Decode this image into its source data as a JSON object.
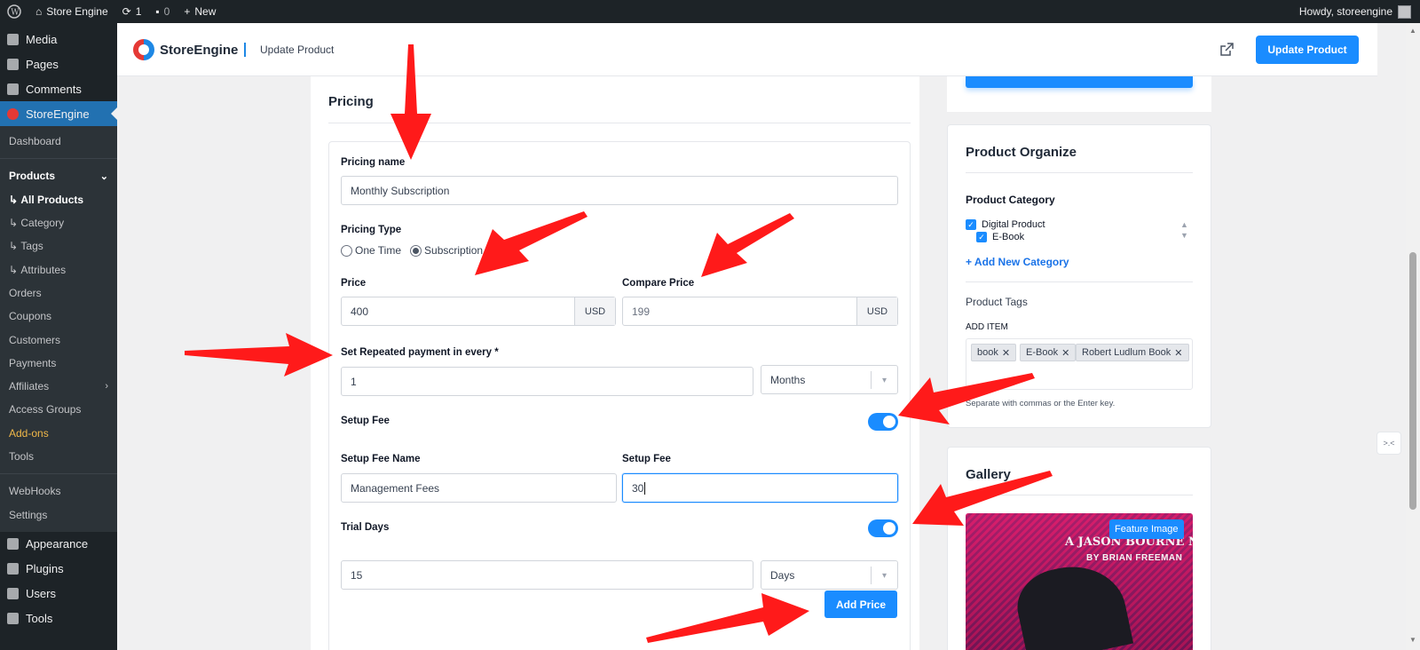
{
  "adminbar": {
    "site_name": "Store Engine",
    "updates_count": "1",
    "comments_count": "0",
    "new_label": "New",
    "howdy": "Howdy, storeengine"
  },
  "sidebar": {
    "top_items": [
      {
        "label": "Media",
        "icon": "media-icon"
      },
      {
        "label": "Pages",
        "icon": "pages-icon"
      },
      {
        "label": "Comments",
        "icon": "comments-icon"
      },
      {
        "label": "StoreEngine",
        "icon": "storeengine-icon"
      }
    ],
    "sub_items": [
      "Dashboard",
      "Products",
      "All Products",
      "Category",
      "Tags",
      "Attributes",
      "Orders",
      "Coupons",
      "Customers",
      "Payments",
      "Affiliates",
      "Access Groups",
      "Add-ons",
      "Tools",
      "WebHooks",
      "Settings"
    ],
    "bottom_items": [
      {
        "label": "Appearance",
        "icon": "appearance-icon"
      },
      {
        "label": "Plugins",
        "icon": "plugins-icon"
      },
      {
        "label": "Users",
        "icon": "users-icon"
      },
      {
        "label": "Tools",
        "icon": "tools-icon"
      }
    ]
  },
  "header": {
    "brand": "StoreEngine",
    "page_name": "Update Product",
    "update_button": "Update Product"
  },
  "pricing": {
    "title": "Pricing",
    "name_label": "Pricing name",
    "name_value": "Monthly Subscription",
    "type_label": "Pricing Type",
    "type_options": [
      "One Time",
      "Subscription"
    ],
    "type_selected": "Subscription",
    "price_label": "Price",
    "price_value": "400",
    "price_currency": "USD",
    "compare_label": "Compare Price",
    "compare_value": "199",
    "compare_currency": "USD",
    "repeat_label": "Set Repeated payment in every *",
    "repeat_value": "1",
    "repeat_unit": "Months",
    "setup_fee_toggle_label": "Setup Fee",
    "setup_fee_enabled": true,
    "setup_fee_name_label": "Setup Fee Name",
    "setup_fee_name_value": "Management Fees",
    "setup_fee_label": "Setup Fee",
    "setup_fee_value": "30",
    "trial_label": "Trial Days",
    "trial_enabled": true,
    "trial_value": "15",
    "trial_unit": "Days",
    "add_price_button": "Add Price"
  },
  "organize": {
    "title": "Product Organize",
    "category_label": "Product Category",
    "categories": [
      {
        "label": "Digital Product",
        "checked": true
      },
      {
        "label": "E-Book",
        "checked": true
      }
    ],
    "add_category": "+ Add New Category",
    "tags_label": "Product Tags",
    "add_item_label": "ADD ITEM",
    "tags": [
      "book",
      "E-Book",
      "Robert Ludlum Book"
    ],
    "tags_help": "Separate with commas or the Enter key."
  },
  "gallery": {
    "title": "Gallery",
    "feature_badge": "Feature Image",
    "cover_line1": "A JASON BOURNE NOVEL",
    "cover_line2": "BY BRIAN FREEMAN"
  },
  "colors": {
    "accent": "#1a8cff",
    "admin_dark": "#1d2327",
    "arrow": "#ff1a1a"
  }
}
